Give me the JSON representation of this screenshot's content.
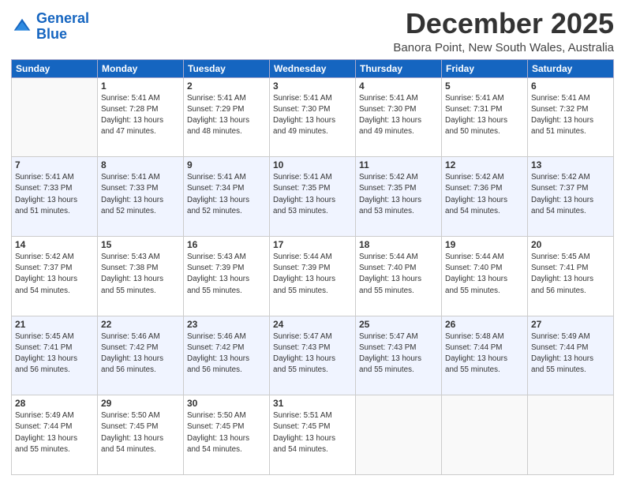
{
  "logo": {
    "line1": "General",
    "line2": "Blue"
  },
  "title": "December 2025",
  "location": "Banora Point, New South Wales, Australia",
  "weekdays": [
    "Sunday",
    "Monday",
    "Tuesday",
    "Wednesday",
    "Thursday",
    "Friday",
    "Saturday"
  ],
  "weeks": [
    [
      {
        "day": "",
        "info": ""
      },
      {
        "day": "1",
        "info": "Sunrise: 5:41 AM\nSunset: 7:28 PM\nDaylight: 13 hours\nand 47 minutes."
      },
      {
        "day": "2",
        "info": "Sunrise: 5:41 AM\nSunset: 7:29 PM\nDaylight: 13 hours\nand 48 minutes."
      },
      {
        "day": "3",
        "info": "Sunrise: 5:41 AM\nSunset: 7:30 PM\nDaylight: 13 hours\nand 49 minutes."
      },
      {
        "day": "4",
        "info": "Sunrise: 5:41 AM\nSunset: 7:30 PM\nDaylight: 13 hours\nand 49 minutes."
      },
      {
        "day": "5",
        "info": "Sunrise: 5:41 AM\nSunset: 7:31 PM\nDaylight: 13 hours\nand 50 minutes."
      },
      {
        "day": "6",
        "info": "Sunrise: 5:41 AM\nSunset: 7:32 PM\nDaylight: 13 hours\nand 51 minutes."
      }
    ],
    [
      {
        "day": "7",
        "info": "Sunrise: 5:41 AM\nSunset: 7:33 PM\nDaylight: 13 hours\nand 51 minutes."
      },
      {
        "day": "8",
        "info": "Sunrise: 5:41 AM\nSunset: 7:33 PM\nDaylight: 13 hours\nand 52 minutes."
      },
      {
        "day": "9",
        "info": "Sunrise: 5:41 AM\nSunset: 7:34 PM\nDaylight: 13 hours\nand 52 minutes."
      },
      {
        "day": "10",
        "info": "Sunrise: 5:41 AM\nSunset: 7:35 PM\nDaylight: 13 hours\nand 53 minutes."
      },
      {
        "day": "11",
        "info": "Sunrise: 5:42 AM\nSunset: 7:35 PM\nDaylight: 13 hours\nand 53 minutes."
      },
      {
        "day": "12",
        "info": "Sunrise: 5:42 AM\nSunset: 7:36 PM\nDaylight: 13 hours\nand 54 minutes."
      },
      {
        "day": "13",
        "info": "Sunrise: 5:42 AM\nSunset: 7:37 PM\nDaylight: 13 hours\nand 54 minutes."
      }
    ],
    [
      {
        "day": "14",
        "info": "Sunrise: 5:42 AM\nSunset: 7:37 PM\nDaylight: 13 hours\nand 54 minutes."
      },
      {
        "day": "15",
        "info": "Sunrise: 5:43 AM\nSunset: 7:38 PM\nDaylight: 13 hours\nand 55 minutes."
      },
      {
        "day": "16",
        "info": "Sunrise: 5:43 AM\nSunset: 7:39 PM\nDaylight: 13 hours\nand 55 minutes."
      },
      {
        "day": "17",
        "info": "Sunrise: 5:44 AM\nSunset: 7:39 PM\nDaylight: 13 hours\nand 55 minutes."
      },
      {
        "day": "18",
        "info": "Sunrise: 5:44 AM\nSunset: 7:40 PM\nDaylight: 13 hours\nand 55 minutes."
      },
      {
        "day": "19",
        "info": "Sunrise: 5:44 AM\nSunset: 7:40 PM\nDaylight: 13 hours\nand 55 minutes."
      },
      {
        "day": "20",
        "info": "Sunrise: 5:45 AM\nSunset: 7:41 PM\nDaylight: 13 hours\nand 56 minutes."
      }
    ],
    [
      {
        "day": "21",
        "info": "Sunrise: 5:45 AM\nSunset: 7:41 PM\nDaylight: 13 hours\nand 56 minutes."
      },
      {
        "day": "22",
        "info": "Sunrise: 5:46 AM\nSunset: 7:42 PM\nDaylight: 13 hours\nand 56 minutes."
      },
      {
        "day": "23",
        "info": "Sunrise: 5:46 AM\nSunset: 7:42 PM\nDaylight: 13 hours\nand 56 minutes."
      },
      {
        "day": "24",
        "info": "Sunrise: 5:47 AM\nSunset: 7:43 PM\nDaylight: 13 hours\nand 55 minutes."
      },
      {
        "day": "25",
        "info": "Sunrise: 5:47 AM\nSunset: 7:43 PM\nDaylight: 13 hours\nand 55 minutes."
      },
      {
        "day": "26",
        "info": "Sunrise: 5:48 AM\nSunset: 7:44 PM\nDaylight: 13 hours\nand 55 minutes."
      },
      {
        "day": "27",
        "info": "Sunrise: 5:49 AM\nSunset: 7:44 PM\nDaylight: 13 hours\nand 55 minutes."
      }
    ],
    [
      {
        "day": "28",
        "info": "Sunrise: 5:49 AM\nSunset: 7:44 PM\nDaylight: 13 hours\nand 55 minutes."
      },
      {
        "day": "29",
        "info": "Sunrise: 5:50 AM\nSunset: 7:45 PM\nDaylight: 13 hours\nand 54 minutes."
      },
      {
        "day": "30",
        "info": "Sunrise: 5:50 AM\nSunset: 7:45 PM\nDaylight: 13 hours\nand 54 minutes."
      },
      {
        "day": "31",
        "info": "Sunrise: 5:51 AM\nSunset: 7:45 PM\nDaylight: 13 hours\nand 54 minutes."
      },
      {
        "day": "",
        "info": ""
      },
      {
        "day": "",
        "info": ""
      },
      {
        "day": "",
        "info": ""
      }
    ]
  ]
}
